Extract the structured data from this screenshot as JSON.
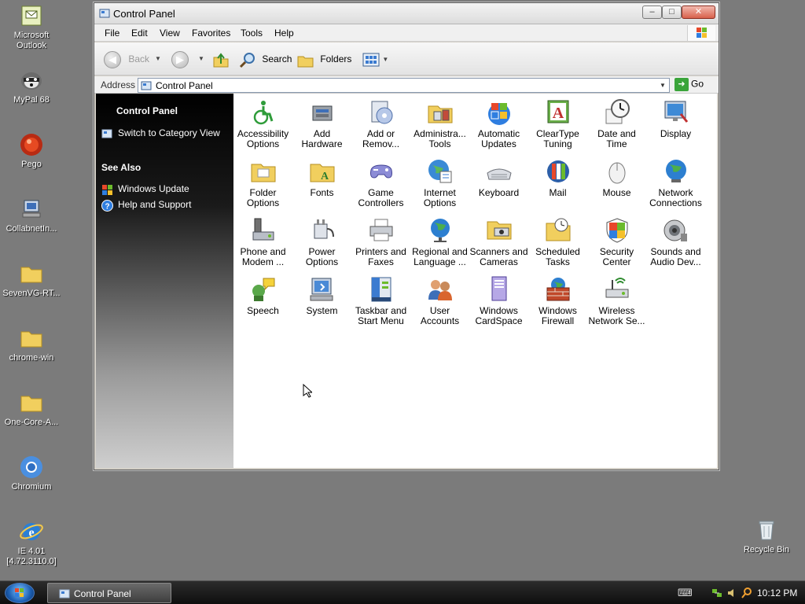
{
  "desktop": {
    "icons": [
      {
        "label": "Microsoft\nOutlook",
        "icon": "outlook-icon"
      },
      {
        "label": "MyPal 68",
        "icon": "mypal-raccoon-icon"
      },
      {
        "label": "Pego",
        "icon": "pego-red-ball-icon"
      },
      {
        "label": "CollabnetIn...",
        "icon": "installer-computer-icon"
      },
      {
        "label": "SevenVG-RT...",
        "icon": "folder-icon"
      },
      {
        "label": "chrome-win",
        "icon": "folder-icon"
      },
      {
        "label": "One-Core-A...",
        "icon": "folder-icon"
      },
      {
        "label": "Chromium",
        "icon": "chromium-icon"
      },
      {
        "label": "IE 4.01\n[4.72.3110.0]",
        "icon": "internet-explorer-icon"
      },
      {
        "label": "Recycle Bin",
        "icon": "recycle-bin-icon"
      }
    ]
  },
  "window": {
    "title": "Control Panel",
    "controls": {
      "minimize": "–",
      "maximize": "□",
      "close": "✕"
    }
  },
  "menu": [
    "File",
    "Edit",
    "View",
    "Favorites",
    "Tools",
    "Help"
  ],
  "toolbar": {
    "back": "Back",
    "search": "Search",
    "folders": "Folders"
  },
  "address": {
    "label": "Address",
    "value": "Control Panel",
    "go": "Go"
  },
  "taskpane": {
    "title": "Control Panel",
    "switch_view": "Switch to Category View",
    "see_also": "See Also",
    "windows_update": "Windows Update",
    "help_support": "Help and Support"
  },
  "items": [
    {
      "label": "Accessibility\nOptions",
      "icon": "accessibility-icon"
    },
    {
      "label": "Add\nHardware",
      "icon": "add-hardware-icon"
    },
    {
      "label": "Add or\nRemov...",
      "icon": "add-remove-programs-icon"
    },
    {
      "label": "Administra...\nTools",
      "icon": "administrative-tools-icon"
    },
    {
      "label": "Automatic\nUpdates",
      "icon": "automatic-updates-icon"
    },
    {
      "label": "ClearType\nTuning",
      "icon": "cleartype-icon"
    },
    {
      "label": "Date and\nTime",
      "icon": "date-time-icon"
    },
    {
      "label": "Display",
      "icon": "display-icon"
    },
    {
      "label": "Folder\nOptions",
      "icon": "folder-options-icon"
    },
    {
      "label": "Fonts",
      "icon": "fonts-icon"
    },
    {
      "label": "Game\nControllers",
      "icon": "game-controllers-icon"
    },
    {
      "label": "Internet\nOptions",
      "icon": "internet-options-icon"
    },
    {
      "label": "Keyboard",
      "icon": "keyboard-icon"
    },
    {
      "label": "Mail",
      "icon": "mail-icon"
    },
    {
      "label": "Mouse",
      "icon": "mouse-icon"
    },
    {
      "label": "Network\nConnections",
      "icon": "network-connections-icon"
    },
    {
      "label": "Phone and\nModem ...",
      "icon": "phone-modem-icon"
    },
    {
      "label": "Power\nOptions",
      "icon": "power-options-icon"
    },
    {
      "label": "Printers and\nFaxes",
      "icon": "printers-faxes-icon"
    },
    {
      "label": "Regional and\nLanguage ...",
      "icon": "regional-language-icon"
    },
    {
      "label": "Scanners and\nCameras",
      "icon": "scanners-cameras-icon"
    },
    {
      "label": "Scheduled\nTasks",
      "icon": "scheduled-tasks-icon"
    },
    {
      "label": "Security\nCenter",
      "icon": "security-center-icon"
    },
    {
      "label": "Sounds and\nAudio Dev...",
      "icon": "sounds-audio-icon"
    },
    {
      "label": "Speech",
      "icon": "speech-icon"
    },
    {
      "label": "System",
      "icon": "system-icon"
    },
    {
      "label": "Taskbar and\nStart Menu",
      "icon": "taskbar-start-menu-icon"
    },
    {
      "label": "User\nAccounts",
      "icon": "user-accounts-icon"
    },
    {
      "label": "Windows\nCardSpace",
      "icon": "windows-cardspace-icon"
    },
    {
      "label": "Windows\nFirewall",
      "icon": "windows-firewall-icon"
    },
    {
      "label": "Wireless\nNetwork Se...",
      "icon": "wireless-network-icon"
    }
  ],
  "taskbar": {
    "task_label": "Control Panel",
    "clock": "10:12 PM"
  }
}
